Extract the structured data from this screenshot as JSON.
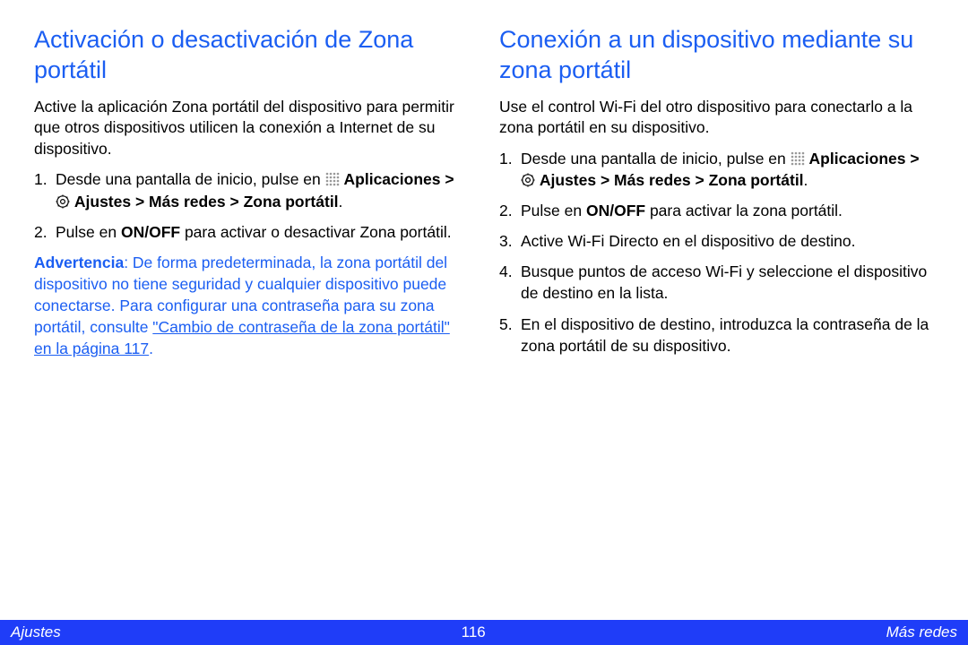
{
  "left": {
    "heading": "Activación o desactivación de Zona portátil",
    "lead": "Active la aplicación Zona portátil del dispositivo para permitir que otros dispositivos utilicen la conexión a Internet de su dispositivo.",
    "step1_a": "Desde una pantalla de inicio, pulse en ",
    "step1_b": "Aplicaciones > ",
    "step1_c": " Ajustes > Más redes > Zona portátil",
    "step1_d": ".",
    "step2_a": "Pulse en ",
    "step2_b": "ON/OFF",
    "step2_c": " para activar o desactivar Zona portátil.",
    "warn_label": "Advertencia",
    "warn_a": ": De forma predeterminada, la zona portátil del dispositivo no tiene seguridad y cualquier dispositivo puede conectarse. Para configurar una contraseña para su zona portátil, consulte ",
    "warn_link": "\"Cambio de contraseña de la zona portátil\" en la página 117",
    "warn_b": "."
  },
  "right": {
    "heading": "Conexión a un dispositivo mediante su zona portátil",
    "lead": "Use el control Wi-Fi del otro dispositivo para conectarlo a la zona portátil en su dispositivo.",
    "step1_a": "Desde una pantalla de inicio, pulse en ",
    "step1_b": "Aplicaciones > ",
    "step1_c": " Ajustes > Más redes > Zona portátil",
    "step1_d": ".",
    "step2_a": "Pulse en ",
    "step2_b": "ON/OFF",
    "step2_c": " para activar la zona portátil.",
    "step3": "Active Wi-Fi Directo en el dispositivo de destino.",
    "step4": "Busque puntos de acceso Wi-Fi y seleccione el dispositivo de destino en la lista.",
    "step5": "En el dispositivo de destino, introduzca la contraseña de la zona portátil de su dispositivo."
  },
  "footer": {
    "left": "Ajustes",
    "center": "116",
    "right": "Más redes"
  }
}
